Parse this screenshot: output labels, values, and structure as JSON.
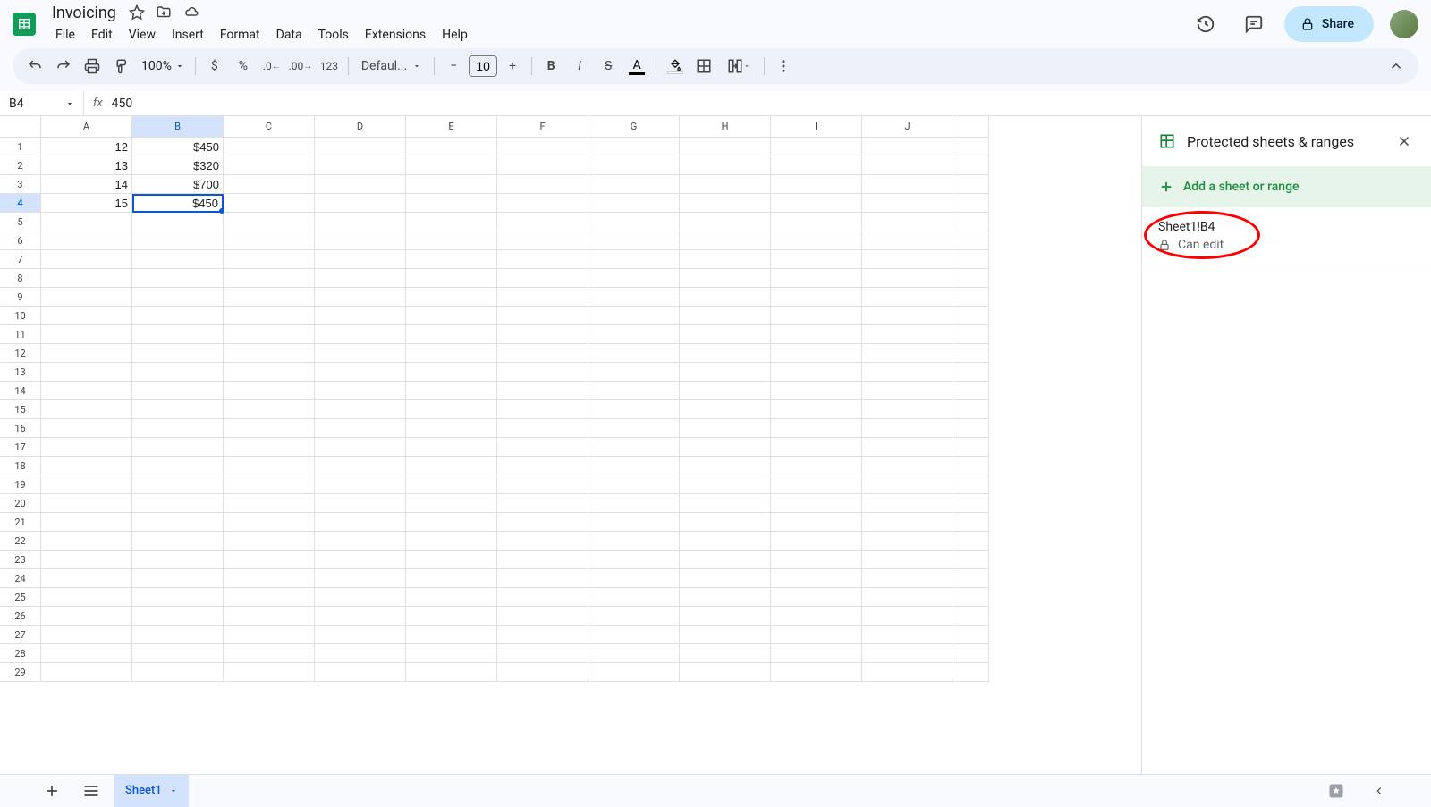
{
  "doc": {
    "title": "Invoicing"
  },
  "menus": [
    "File",
    "Edit",
    "View",
    "Insert",
    "Format",
    "Data",
    "Tools",
    "Extensions",
    "Help"
  ],
  "share_label": "Share",
  "toolbar": {
    "zoom": "100%",
    "font": "Defaul...",
    "font_size": "10"
  },
  "name_box": "B4",
  "formula": "450",
  "columns": [
    "A",
    "B",
    "C",
    "D",
    "E",
    "F",
    "G",
    "H",
    "I",
    "J"
  ],
  "rows": [
    1,
    2,
    3,
    4,
    5,
    6,
    7,
    8,
    9,
    10,
    11,
    12,
    13,
    14,
    15,
    16,
    17,
    18,
    19,
    20,
    21,
    22,
    23,
    24,
    25,
    26,
    27,
    28,
    29
  ],
  "cells": {
    "A1": "12",
    "B1": "$450",
    "A2": "13",
    "B2": "$320",
    "A3": "14",
    "B3": "$700",
    "A4": "15",
    "B4": "$450"
  },
  "selected_cell": "B4",
  "panel": {
    "title": "Protected sheets & ranges",
    "add_label": "Add a sheet or range",
    "range_name": "Sheet1!B4",
    "range_status": "Can edit"
  },
  "sheet_tab": "Sheet1"
}
